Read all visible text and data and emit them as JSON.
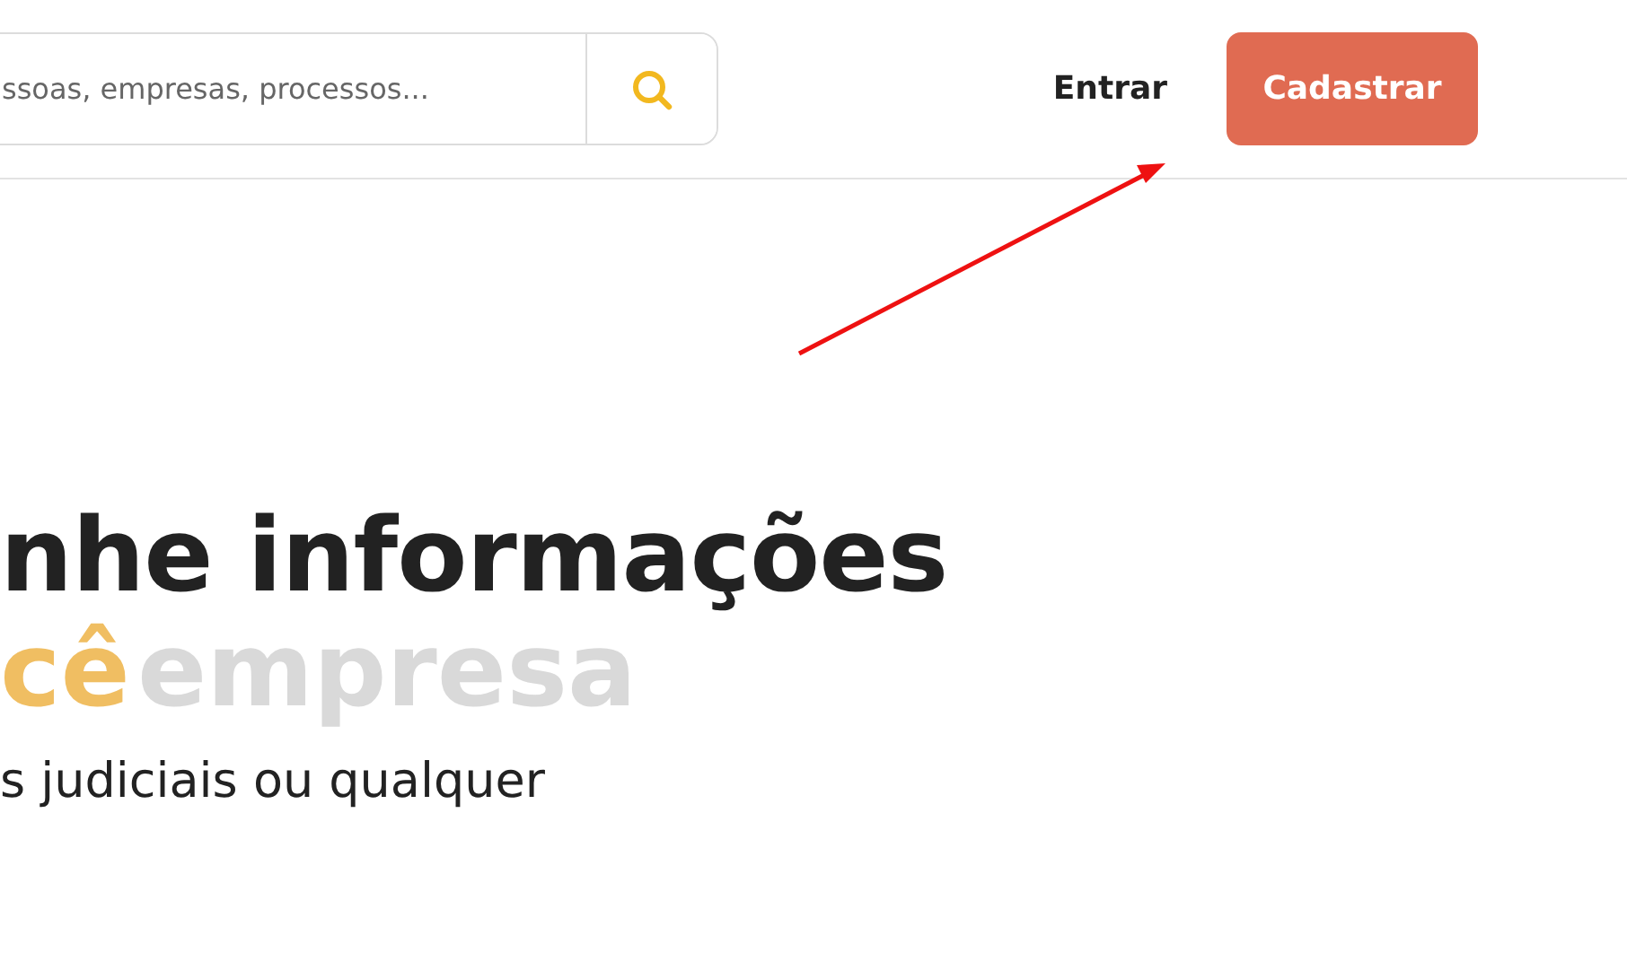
{
  "header": {
    "search": {
      "placeholder": "ssoas, empresas, processos..."
    },
    "login_link": "Entrar",
    "signup_button": "Cadastrar"
  },
  "annotation": {
    "kind": "arrow"
  },
  "hero": {
    "headline_line_1": "nhe informações",
    "headline_line_2_highlight": "cê",
    "headline_line_2_faded": "empresa",
    "subtitle": "s judiciais ou qualquer"
  }
}
